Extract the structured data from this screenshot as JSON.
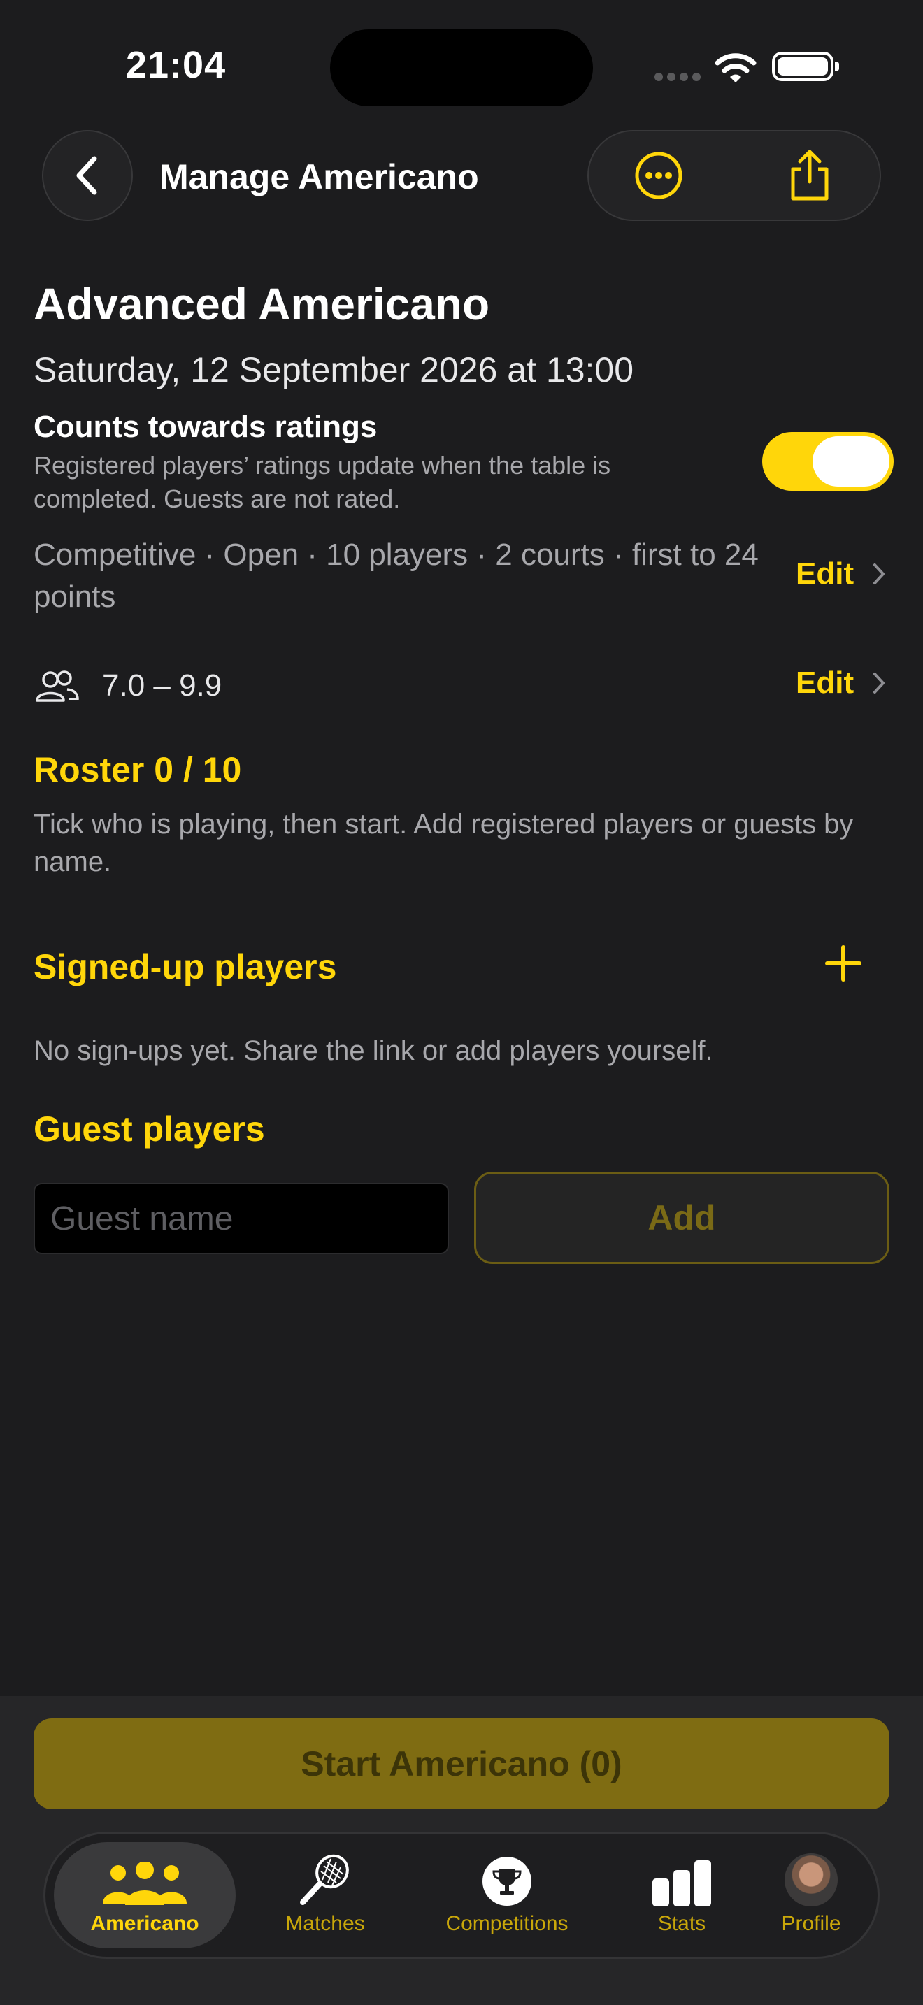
{
  "status_bar": {
    "time": "21:04"
  },
  "nav": {
    "title": "Manage Americano"
  },
  "event": {
    "title": "Advanced Americano",
    "date": "Saturday, 12 September 2026 at 13:00",
    "ratings_title": "Counts towards ratings",
    "ratings_description": "Registered players’ ratings update when the table is completed. Guests are not rated.",
    "ratings_toggle_on": true,
    "config": "Competitive · Open · 10 players · 2 courts · first to 24 points",
    "edit_label": "Edit",
    "rating_range": "7.0 – 9.9"
  },
  "roster": {
    "title": "Roster 0 / 10",
    "hint": "Tick who is playing, then start. Add registered players or guests by name."
  },
  "signed_up": {
    "title": "Signed-up players",
    "empty": "No sign-ups yet. Share the link or add players yourself."
  },
  "guests": {
    "title": "Guest players",
    "placeholder": "Guest name",
    "value": "",
    "add_label": "Add"
  },
  "start_button": "Start Americano (0)",
  "tabs": [
    {
      "label": "Americano",
      "icon": "people-icon",
      "active": true
    },
    {
      "label": "Matches",
      "icon": "racket-icon"
    },
    {
      "label": "Competitions",
      "icon": "trophy-icon"
    },
    {
      "label": "Stats",
      "icon": "bar-chart-icon"
    },
    {
      "label": "Profile",
      "icon": "avatar"
    }
  ],
  "colors": {
    "accent": "#ffd60a",
    "background": "#1c1c1e",
    "muted_text": "#a8a8ac"
  }
}
